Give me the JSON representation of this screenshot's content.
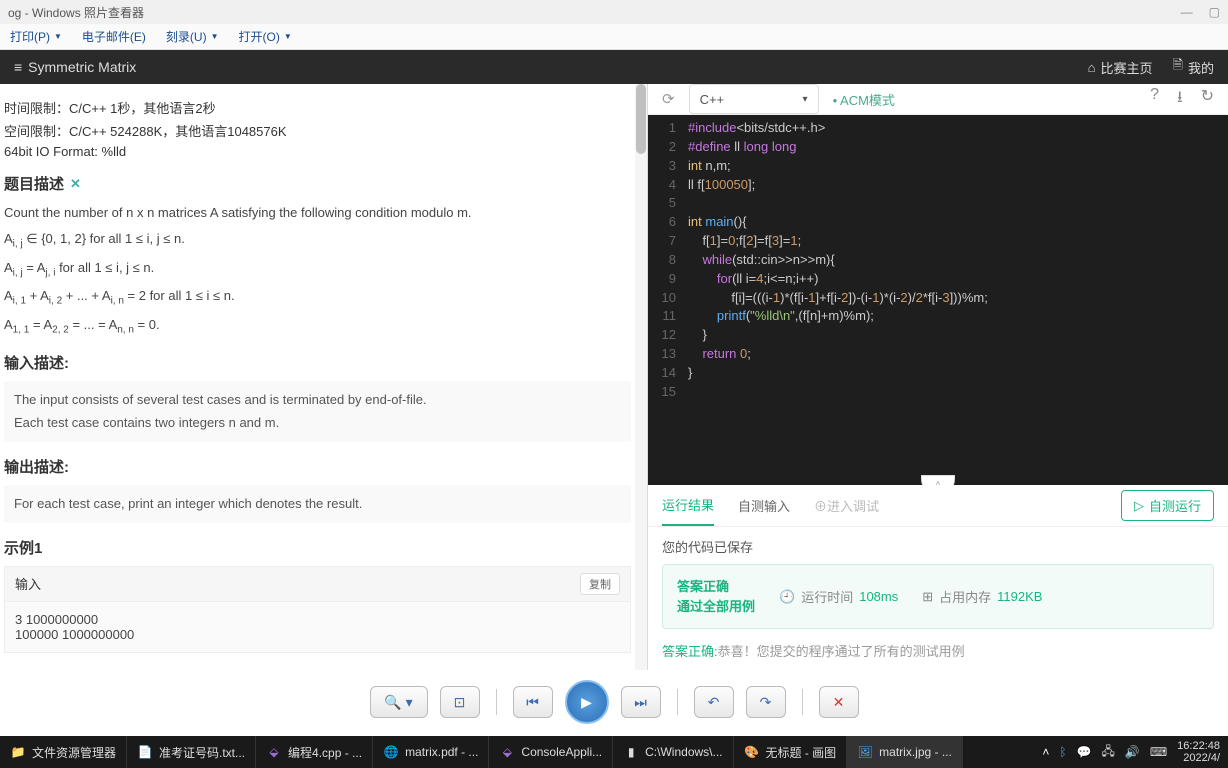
{
  "titlebar": {
    "title": "og - Windows 照片查看器"
  },
  "menubar": {
    "print": "打印(P)",
    "email": "电子邮件(E)",
    "burn": "刻录(U)",
    "open": "打开(O)"
  },
  "header": {
    "title": "Symmetric Matrix",
    "home": "比赛主页",
    "profile": "我的"
  },
  "problem": {
    "time_limit": "时间限制：C/C++ 1秒，其他语言2秒",
    "mem_limit": "空间限制：C/C++ 524288K，其他语言1048576K",
    "io_format": "64bit IO Format: %lld",
    "desc_title": "题目描述",
    "desc": "Count the number of n x n matrices A satisfying the following condition modulo m.",
    "cond1a": "A",
    "cond1b": " ∈ {0, 1, 2} for all 1 ≤ i, j ≤ n.",
    "cond2": " for all 1 ≤ i, j ≤ n.",
    "cond3a": "A",
    "cond3b": " + A",
    "cond3c": " + ... + A",
    "cond3d": " = 2 for all 1 ≤ i ≤ n.",
    "cond4a": "A",
    "cond4b": " = A",
    "cond4c": " = ... = A",
    "cond4d": " = 0.",
    "input_title": "输入描述:",
    "input_desc1": "The input consists of several test cases and is terminated by end-of-file.",
    "input_desc2": "Each test case contains two integers n and m.",
    "output_title": "输出描述:",
    "output_desc": "For each test case, print an integer which denotes the result.",
    "example_title": "示例1",
    "input_label": "输入",
    "copy": "复制",
    "example_input1": "3 1000000000",
    "example_input2": "100000 1000000000"
  },
  "editor": {
    "lang": "C++",
    "mode": "ACM模式",
    "code": [
      "#include<bits/stdc++.h>",
      "#define ll long long",
      "int n,m;",
      "ll f[100050];",
      "",
      "int main(){",
      "    f[1]=0;f[2]=f[3]=1;",
      "    while(std::cin>>n>>m){",
      "        for(ll i=4;i<=n;i++)",
      "            f[i]=(((i-1)*(f[i-1]+f[i-2])-(i-1)*(i-2)/2*f[i-3]))%m;",
      "        printf(\"%lld\\n\",(f[n]+m)%m);",
      "    }",
      "    return 0;",
      "}",
      ""
    ]
  },
  "results": {
    "tab_run": "运行结果",
    "tab_input": "自测输入",
    "tab_debug": "进入调试",
    "selftest_btn": "自测运行",
    "saved": "您的代码已保存",
    "verdict1": "答案正确",
    "verdict2": "通过全部用例",
    "time_label": "运行时间",
    "time_val": "108ms",
    "mem_label": "占用内存",
    "mem_val": "1192KB",
    "note_prefix": "答案正确:",
    "note_text": "恭喜！您提交的程序通过了所有的测试用例"
  },
  "taskbar": {
    "explorer": "文件资源管理器",
    "notepad": "准考证号码.txt...",
    "vs1": "编程4.cpp - ...",
    "chrome": "matrix.pdf - ...",
    "vs2": "ConsoleAppli...",
    "cmd": "C:\\Windows\\...",
    "paint": "无标题 - 画图",
    "photos": "matrix.jpg - ...",
    "time": "16:22:48",
    "date": "2022/4/"
  }
}
